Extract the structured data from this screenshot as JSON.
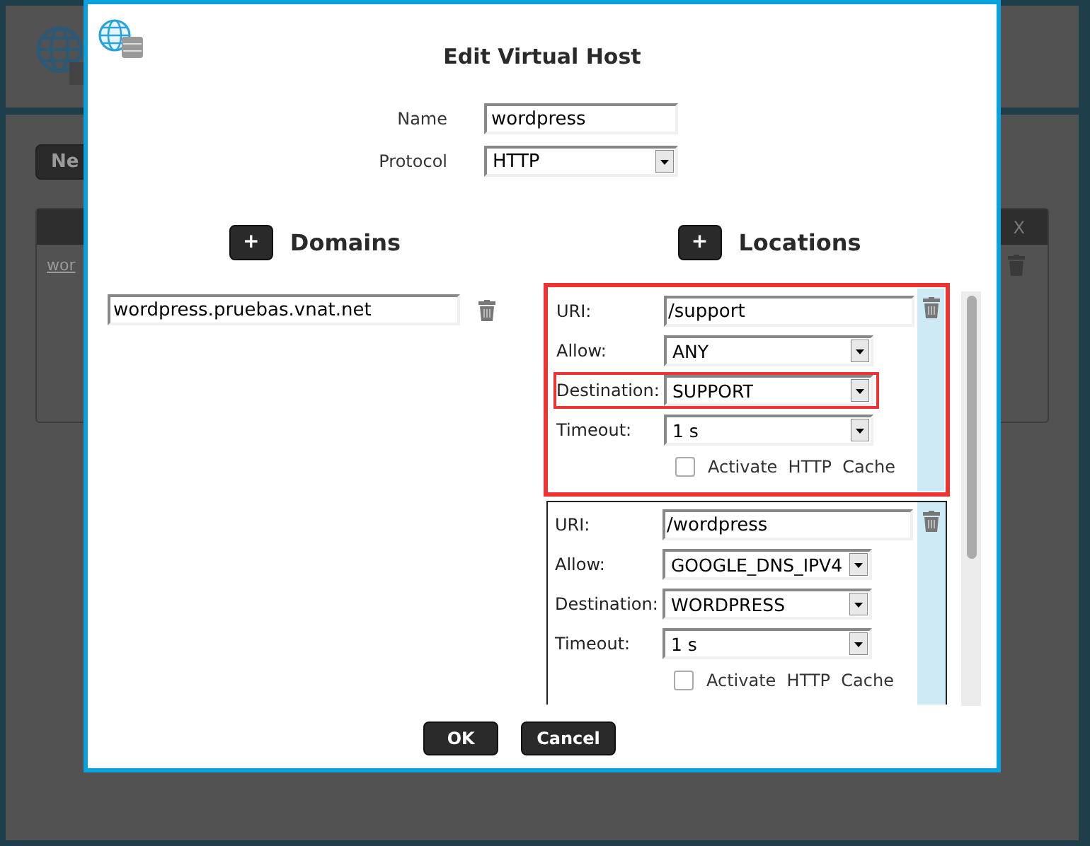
{
  "background": {
    "new_button": "Ne",
    "table_header": "X",
    "table_link": "wor"
  },
  "dialog": {
    "title": "Edit Virtual Host",
    "name_label": "Name",
    "name_value": "wordpress",
    "protocol_label": "Protocol",
    "protocol_value": "HTTP"
  },
  "domains": {
    "add_button": "+",
    "heading": "Domains",
    "items": [
      {
        "value": "wordpress.pruebas.vnat.net"
      }
    ]
  },
  "locations": {
    "add_button": "+",
    "heading": "Locations",
    "items": [
      {
        "highlighted": true,
        "fields": [
          {
            "kind": "text",
            "label": "URI:",
            "value": "/support",
            "highlighted": false
          },
          {
            "kind": "select",
            "label": "Allow:",
            "value": "ANY",
            "highlighted": false
          },
          {
            "kind": "select",
            "label": "Destination:",
            "value": "SUPPORT",
            "highlighted": true
          },
          {
            "kind": "select",
            "label": "Timeout:",
            "value": "1 s",
            "highlighted": false
          }
        ],
        "cache_label": "Activate  HTTP  Cache",
        "cache_checked": false
      },
      {
        "highlighted": false,
        "fields": [
          {
            "kind": "text",
            "label": "URI:",
            "value": "/wordpress",
            "highlighted": false
          },
          {
            "kind": "select",
            "label": "Allow:",
            "value": "GOOGLE_DNS_IPV4",
            "highlighted": false
          },
          {
            "kind": "select",
            "label": "Destination:",
            "value": "WORDPRESS",
            "highlighted": false
          },
          {
            "kind": "select",
            "label": "Timeout:",
            "value": "1 s",
            "highlighted": false
          }
        ],
        "cache_label": "Activate  HTTP  Cache",
        "cache_checked": false
      }
    ]
  },
  "buttons": [
    {
      "label": "OK"
    },
    {
      "label": "Cancel"
    }
  ]
}
